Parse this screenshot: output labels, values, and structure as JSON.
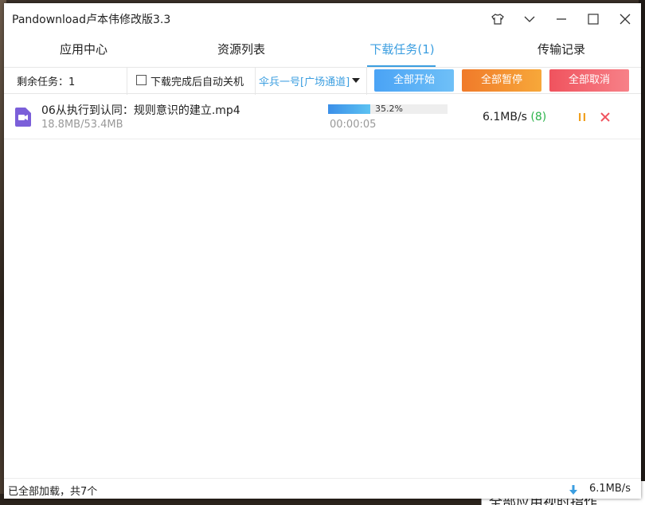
{
  "window": {
    "title": "Pandownload卢本伟修改版3.3"
  },
  "tabs": [
    {
      "label": "应用中心"
    },
    {
      "label": "资源列表"
    },
    {
      "label": "下载任务(1)"
    },
    {
      "label": "传输记录"
    }
  ],
  "toolbar": {
    "remaining": "剩余任务：1",
    "auto_shutdown_label": "下载完成后自动关机",
    "auto_shutdown_checked": false,
    "channel": "伞兵一号[广场通道]",
    "start_all": "全部开始",
    "pause_all": "全部暂停",
    "cancel_all": "全部取消"
  },
  "tasks": [
    {
      "name": "06从执行到认同：规则意识的建立.mp4",
      "size": "18.8MB/53.4MB",
      "progress_percent": 35.2,
      "progress_label": "35.2%",
      "elapsed": "00:00:05",
      "speed": "6.1MB/s",
      "connections": "(8)"
    }
  ],
  "statusbar": {
    "text": "已全部加载，共7个",
    "speed": "6.1MB/s"
  },
  "desktop": {
    "partial_text": "全部应用视时指作"
  },
  "colors": {
    "accent": "#3b9ee0",
    "start": "#4aa3f5",
    "pause": "#f07a2a",
    "cancel": "#f0535e",
    "connections": "#2bb34a"
  }
}
